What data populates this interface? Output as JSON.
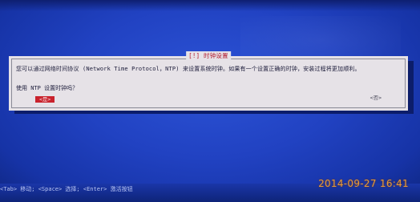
{
  "dialog": {
    "title": "[!] 时钟设置",
    "message": "您可以通过网络时间协议 (Network Time Protocol，NTP) 来设置系统时钟。如果有一个设置正确的时钟，安装过程将更加顺利。",
    "question": "使用 NTP 设置时钟吗？",
    "yes_label": "<是>",
    "no_label": "<否>"
  },
  "status_bar": {
    "help_text": "<Tab> 移动; <Space> 选择; <Enter> 激活按钮"
  },
  "overlay": {
    "timestamp": "2014-09-27 16:41"
  },
  "colors": {
    "background": "#2142c2",
    "dialog_bg": "#e6e2e7",
    "title_color": "#b31a2e",
    "selected_button": "#c9222c",
    "timestamp_color": "#e79a3a"
  }
}
